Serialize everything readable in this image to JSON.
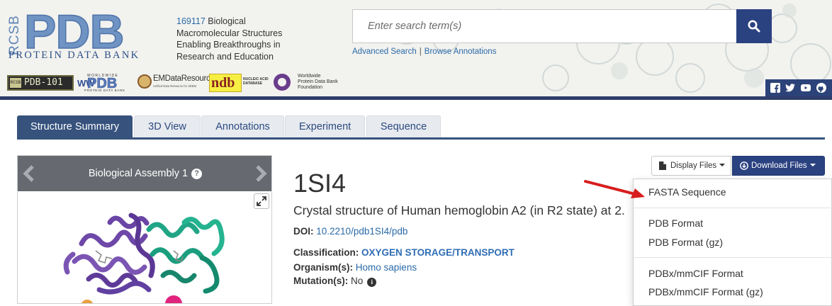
{
  "header": {
    "logo": {
      "rcsb": "RCSB",
      "pdb": "PDB",
      "subtitle": "PROTEIN DATA BANK"
    },
    "tagline": {
      "count": "169117",
      "text": " Biological Macromolecular Structures Enabling Breakthroughs in Research and Education"
    },
    "partners": {
      "pdb101": "PDB-101",
      "pdb101_tag": "RCSB",
      "wwpdb_small": "WORLDWIDE",
      "wwpdb_ww": "WW",
      "wwpdb_big": "PDB",
      "wwpdb_sub": "PROTEIN DATA BANK",
      "emdb": "EMDataResource",
      "emdb_sub": "Unified Data Resource for 3DEM",
      "ndb": "ndb",
      "ndb_sub1": "NUCLEIC ACID",
      "ndb_sub2": "DATABASE",
      "wpdbf1": "Worldwide",
      "wpdbf2": "Protein Data Bank",
      "wpdbf3": "Foundation"
    },
    "search": {
      "placeholder": "Enter search term(s)"
    },
    "links": {
      "advanced": "Advanced Search",
      "separator": "|",
      "browse": "Browse Annotations"
    },
    "social": [
      "facebook-icon",
      "twitter-icon",
      "youtube-icon",
      "github-icon"
    ]
  },
  "tabs": [
    {
      "label": "Structure Summary",
      "active": true
    },
    {
      "label": "3D View"
    },
    {
      "label": "Annotations"
    },
    {
      "label": "Experiment"
    },
    {
      "label": "Sequence"
    }
  ],
  "viewer": {
    "title": "Biological Assembly 1",
    "help": "?"
  },
  "structure": {
    "id": "1SI4",
    "title": "Crystal structure of Human hemoglobin A2 (in R2 state) at 2.",
    "doi_label": "DOI:",
    "doi": "10.2210/pdb1SI4/pdb",
    "classification_label": "Classification:",
    "classification": "OXYGEN STORAGE/TRANSPORT",
    "organism_label": "Organism(s):",
    "organism": "Homo sapiens",
    "mutation_label": "Mutation(s):",
    "mutation": "No",
    "info": "i"
  },
  "buttons": {
    "display_files": "Display Files",
    "download_files": "Download Files"
  },
  "download_menu": [
    "FASTA Sequence",
    "PDB Format",
    "PDB Format (gz)",
    "PDBx/mmCIF Format",
    "PDBx/mmCIF Format (gz)"
  ],
  "colors": {
    "brand": "#2b4281",
    "tab_active": "#36527d",
    "link": "#2a6aa8",
    "arrow": "#d81d1d"
  }
}
